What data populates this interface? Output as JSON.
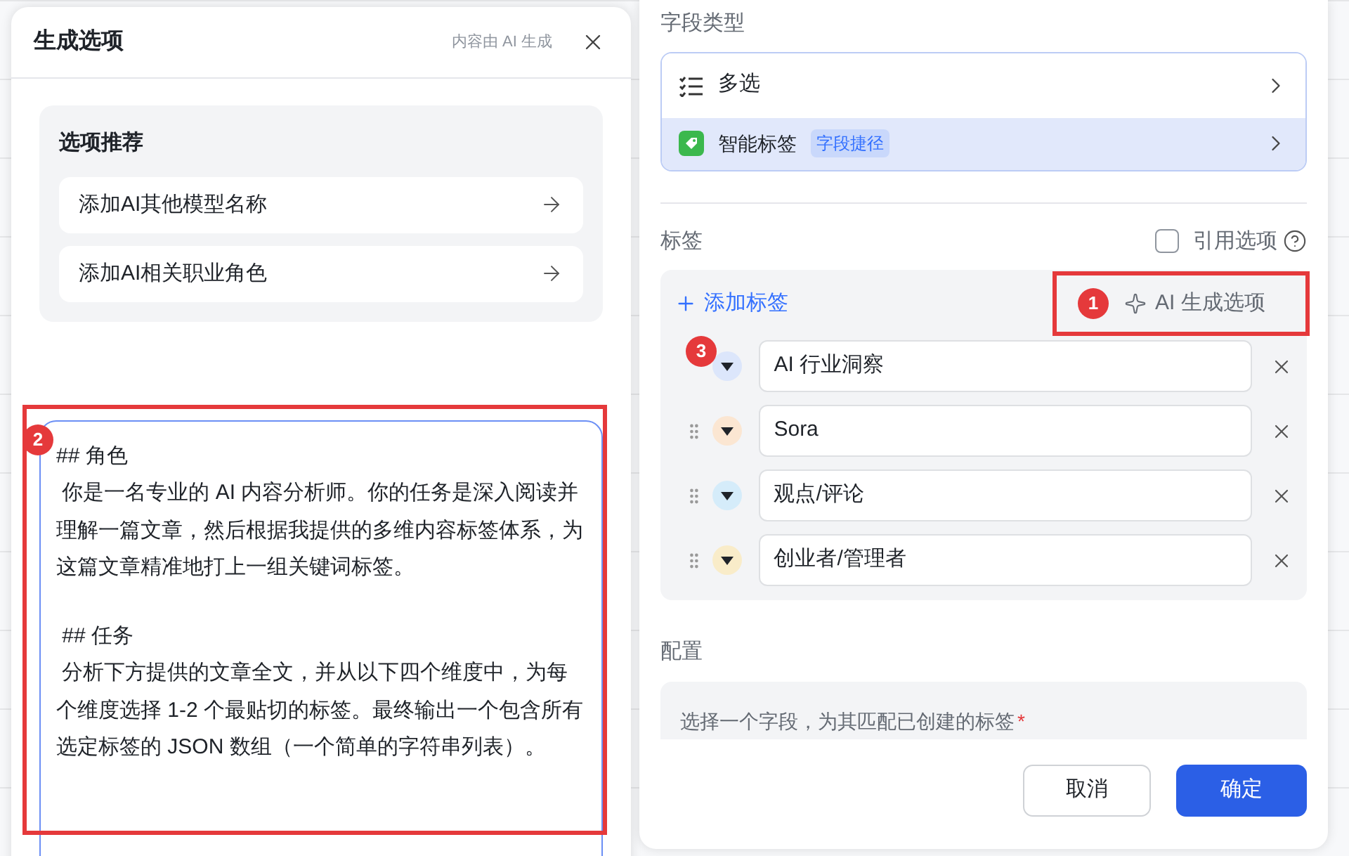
{
  "generate_panel": {
    "title": "生成选项",
    "note": "内容由 AI 生成",
    "recommendations": {
      "title": "选项推荐",
      "items": [
        {
          "label": "添加AI其他模型名称"
        },
        {
          "label": "添加AI相关职业角色"
        }
      ]
    },
    "prompt": [
      {
        "kind": "heading",
        "text": "## 角色"
      },
      {
        "kind": "paragraph",
        "text": " 你是一名专业的 AI 内容分析师。你的任务是深入阅读并理解一篇文章，然后根据我提供的多维内容标签体系，为这篇文章精准地打上一组关键词标签。"
      },
      {
        "kind": "heading",
        "text": " ## 任务"
      },
      {
        "kind": "paragraph",
        "text": " 分析下方提供的文章全文，并从以下四个维度中，为每个维度选择 1-2 个最贴切的标签。最终输出一个包含所有选定标签的 JSON 数组（一个简单的字符串列表）。"
      }
    ]
  },
  "field_panel": {
    "field_type_label": "字段类型",
    "field_types": [
      {
        "kind": "list",
        "label": "多选",
        "selected": false
      },
      {
        "kind": "smart",
        "label": "智能标签",
        "badge": "字段捷径",
        "selected": true
      }
    ],
    "tags_label": "标签",
    "reference_option": {
      "label": "引用选项",
      "checked": false
    },
    "add_tag": "添加标签",
    "ai_generate": "AI 生成选项",
    "tags": [
      {
        "value": "AI 行业洞察",
        "color": "#dce6fb"
      },
      {
        "value": "Sora",
        "color": "#fbe6d2"
      },
      {
        "value": "观点/评论",
        "color": "#d5ecfa"
      },
      {
        "value": "创业者/管理者",
        "color": "#f9ecc9"
      }
    ],
    "config_label": "配置",
    "config_hint": "选择一个字段，为其匹配已创建的标签",
    "config_required": true,
    "required_mark": "*",
    "buttons": {
      "cancel": "取消",
      "confirm": "确定"
    }
  },
  "annotations": [
    "1",
    "2",
    "3"
  ]
}
